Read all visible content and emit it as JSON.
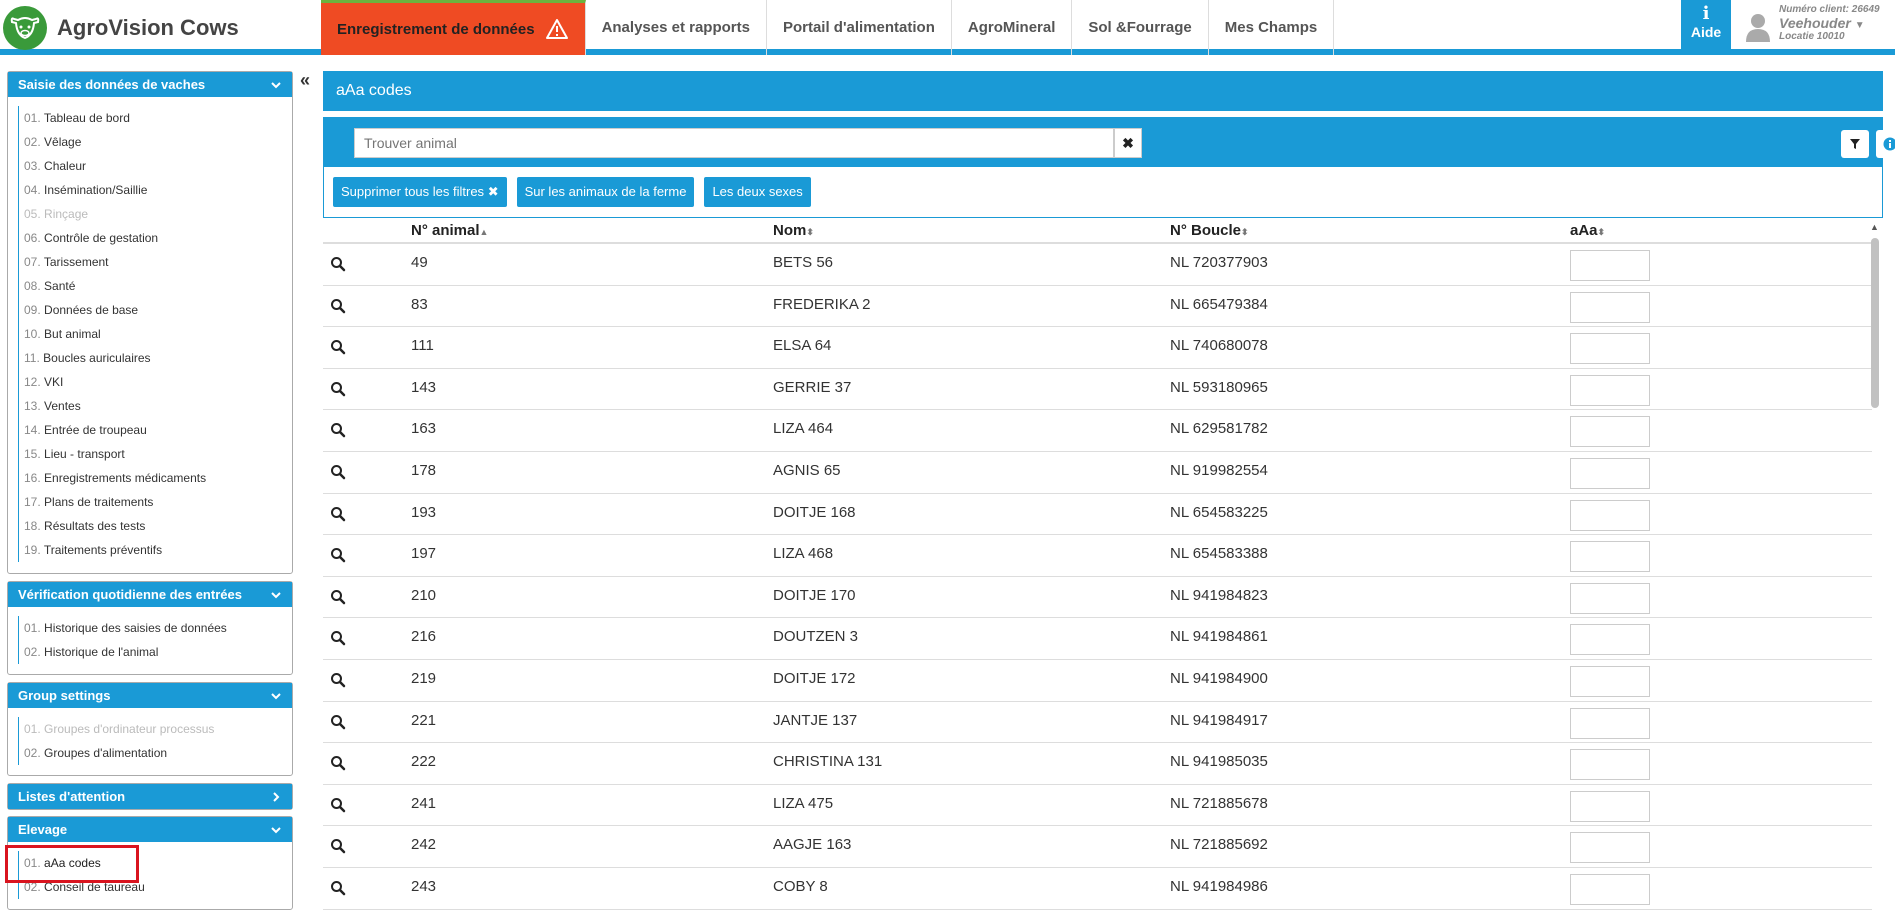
{
  "app": {
    "title": "AgroVision Cows"
  },
  "nav": {
    "items": [
      {
        "label": "Enregistrement de données",
        "active": true
      },
      {
        "label": "Analyses et rapports"
      },
      {
        "label": "Portail d'alimentation"
      },
      {
        "label": "AgroMineral"
      },
      {
        "label": "Sol &Fourrage"
      },
      {
        "label": "Mes Champs"
      }
    ]
  },
  "help": {
    "label": "Aide",
    "icon": "info-icon"
  },
  "user": {
    "client": "Numéro client: 26649",
    "name": "Veehouder",
    "location": "Locatie 10010"
  },
  "sidebar": {
    "panels": [
      {
        "title": "Saisie des données de vaches",
        "items": [
          {
            "num": "01.",
            "label": "Tableau de bord"
          },
          {
            "num": "02.",
            "label": "Vêlage"
          },
          {
            "num": "03.",
            "label": "Chaleur"
          },
          {
            "num": "04.",
            "label": "Insémination/Saillie"
          },
          {
            "num": "05.",
            "label": "Rinçage",
            "disabled": true
          },
          {
            "num": "06.",
            "label": "Contrôle de gestation"
          },
          {
            "num": "07.",
            "label": "Tarissement"
          },
          {
            "num": "08.",
            "label": "Santé"
          },
          {
            "num": "09.",
            "label": "Données de base"
          },
          {
            "num": "10.",
            "label": "But animal"
          },
          {
            "num": "11.",
            "label": "Boucles auriculaires"
          },
          {
            "num": "12.",
            "label": "VKI"
          },
          {
            "num": "13.",
            "label": "Ventes"
          },
          {
            "num": "14.",
            "label": "Entrée de troupeau"
          },
          {
            "num": "15.",
            "label": "Lieu - transport"
          },
          {
            "num": "16.",
            "label": "Enregistrements médicaments"
          },
          {
            "num": "17.",
            "label": "Plans de traitements"
          },
          {
            "num": "18.",
            "label": "Résultats des tests"
          },
          {
            "num": "19.",
            "label": "Traitements préventifs"
          }
        ]
      },
      {
        "title": "Vérification quotidienne des entrées",
        "items": [
          {
            "num": "01.",
            "label": "Historique des saisies de données"
          },
          {
            "num": "02.",
            "label": "Historique de l'animal"
          }
        ]
      },
      {
        "title": "Group settings",
        "items": [
          {
            "num": "01.",
            "label": "Groupes d'ordinateur processus",
            "disabled": true
          },
          {
            "num": "02.",
            "label": "Groupes d'alimentation"
          }
        ]
      },
      {
        "title": "Listes d'attention",
        "items": []
      },
      {
        "title": "Elevage",
        "items": [
          {
            "num": "01.",
            "label": "aAa codes",
            "active": true
          },
          {
            "num": "02.",
            "label": "Conseil de taureau"
          }
        ]
      }
    ]
  },
  "main": {
    "title": "aAa codes",
    "search": {
      "placeholder": "Trouver animal"
    },
    "filters": [
      {
        "label": "Supprimer tous les filtres"
      },
      {
        "label": "Sur les animaux de la ferme"
      },
      {
        "label": "Les deux sexes"
      }
    ]
  },
  "table": {
    "columns": [
      "N° animal",
      "Nom",
      "N° Boucle",
      "aAa"
    ],
    "rows": [
      {
        "num": "49",
        "name": "BETS 56",
        "tag": "NL 720377903"
      },
      {
        "num": "83",
        "name": "FREDERIKA 2",
        "tag": "NL 665479384"
      },
      {
        "num": "111",
        "name": "ELSA 64",
        "tag": "NL 740680078"
      },
      {
        "num": "143",
        "name": "GERRIE 37",
        "tag": "NL 593180965"
      },
      {
        "num": "163",
        "name": "LIZA 464",
        "tag": "NL 629581782"
      },
      {
        "num": "178",
        "name": "AGNIS 65",
        "tag": "NL 919982554"
      },
      {
        "num": "193",
        "name": "DOITJE 168",
        "tag": "NL 654583225"
      },
      {
        "num": "197",
        "name": "LIZA 468",
        "tag": "NL 654583388"
      },
      {
        "num": "210",
        "name": "DOITJE 170",
        "tag": "NL 941984823"
      },
      {
        "num": "216",
        "name": "DOUTZEN 3",
        "tag": "NL 941984861"
      },
      {
        "num": "219",
        "name": "DOITJE 172",
        "tag": "NL 941984900"
      },
      {
        "num": "221",
        "name": "JANTJE 137",
        "tag": "NL 941984917"
      },
      {
        "num": "222",
        "name": "CHRISTINA 131",
        "tag": "NL 941985035"
      },
      {
        "num": "241",
        "name": "LIZA 475",
        "tag": "NL 721885678"
      },
      {
        "num": "242",
        "name": "AAGJE 163",
        "tag": "NL 721885692"
      },
      {
        "num": "243",
        "name": "COBY 8",
        "tag": "NL 941984986"
      }
    ]
  },
  "colors": {
    "primary": "#1a9ad6",
    "active_nav": "#ef4b23",
    "highlight": "#d9141f"
  }
}
